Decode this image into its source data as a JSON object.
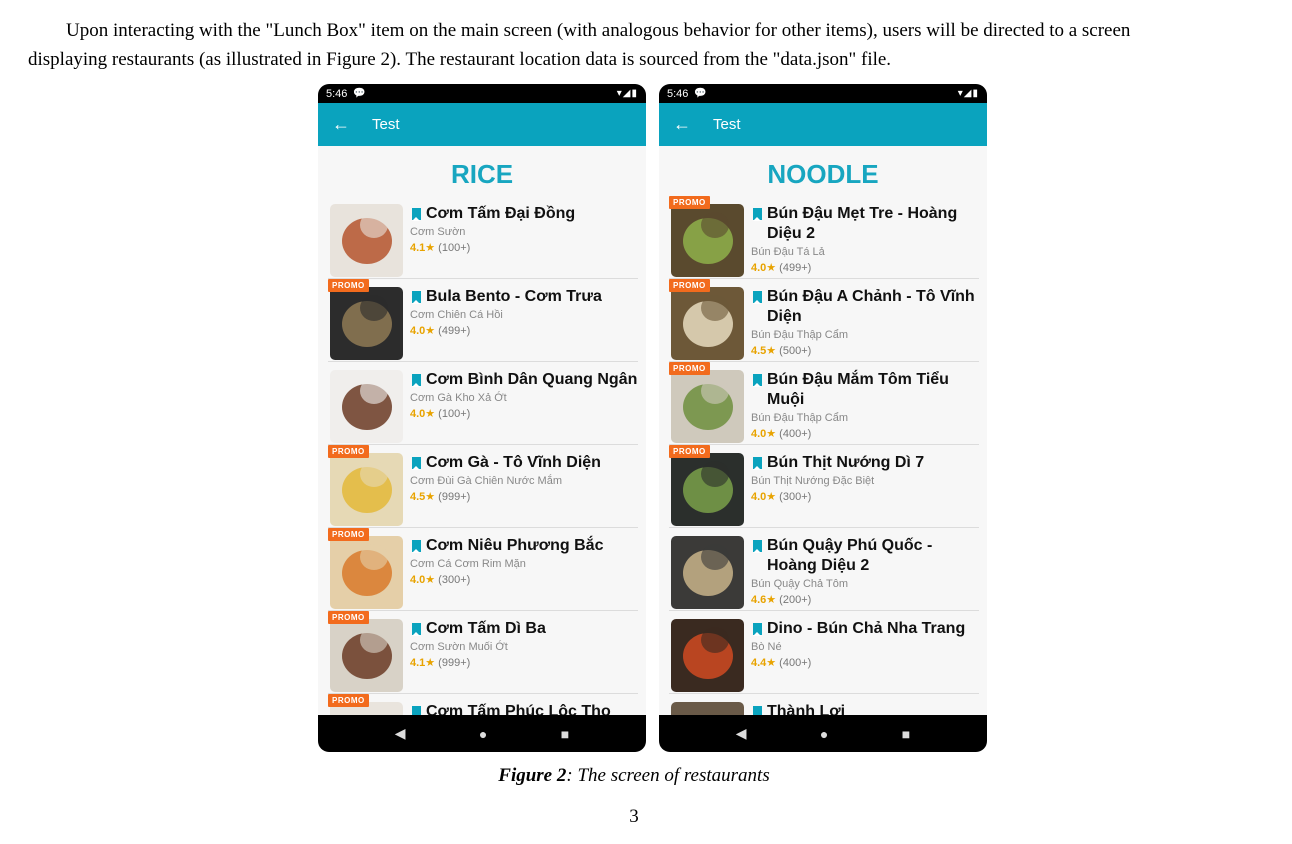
{
  "paragraph": {
    "line1": "Upon interacting with the \"Lunch Box\" item on the main screen (with analogous behavior for other items), users will be directed to a screen",
    "line2": "displaying restaurants (as illustrated in Figure 2). The restaurant location data is sourced from the \"data.json\" file."
  },
  "phones": [
    {
      "status": {
        "time": "5:46",
        "notif_icon": "chat-icon",
        "sys_icons": "wifi-signal-battery-icons"
      },
      "appbar": {
        "back_icon": "arrow-left-icon",
        "title": "Test"
      },
      "heading": "RICE",
      "items": [
        {
          "promo": false,
          "name": "Cơm Tấm Đại Đồng",
          "sub": "Cơm Sườn",
          "score": "4.1",
          "count": "(100+)",
          "colors": [
            "#e8e3dc",
            "#b5552e"
          ]
        },
        {
          "promo": true,
          "name": "Bula Bento - Cơm Trưa",
          "sub": "Cơm Chiên Cá Hồi",
          "score": "4.0",
          "count": "(499+)",
          "colors": [
            "#2c2c2c",
            "#8f7a55"
          ]
        },
        {
          "promo": false,
          "name": "Cơm Bình Dân Quang Ngân",
          "sub": "Cơm Gà Kho Xả Ớt",
          "score": "4.0",
          "count": "(100+)",
          "colors": [
            "#f0eeec",
            "#6b3a24"
          ]
        },
        {
          "promo": true,
          "name": "Cơm Gà - Tô Vĩnh Diện",
          "sub": "Cơm Đùi Gà Chiên Nước Mắm",
          "score": "4.5",
          "count": "(999+)",
          "colors": [
            "#e6d9b5",
            "#e3b83a"
          ]
        },
        {
          "promo": true,
          "name": "Cơm Niêu Phương Bắc",
          "sub": "Cơm Cá Cơm Rim Mặn",
          "score": "4.0",
          "count": "(300+)",
          "colors": [
            "#e5cfa8",
            "#d97a2b"
          ]
        },
        {
          "promo": true,
          "name": "Cơm Tấm Dì Ba",
          "sub": "Cơm Sườn Muối Ớt",
          "score": "4.1",
          "count": "(999+)",
          "colors": [
            "#d8d2c7",
            "#6b3b24"
          ]
        },
        {
          "promo": true,
          "name": "Cơm Tấm Phúc Lộc Thọ",
          "sub": "",
          "score": "",
          "count": "",
          "colors": [
            "#e9e4dd",
            "#c79a5a"
          ]
        }
      ],
      "nav": {
        "back": "◀",
        "home": "●",
        "recent": "■"
      }
    },
    {
      "status": {
        "time": "5:46",
        "notif_icon": "chat-icon",
        "sys_icons": "wifi-signal-battery-icons"
      },
      "appbar": {
        "back_icon": "arrow-left-icon",
        "title": "Test"
      },
      "heading": "NOODLE",
      "items": [
        {
          "promo": true,
          "name": "Bún Đậu Mẹt Tre - Hoàng Diệu 2",
          "sub": "Bún Đậu Tá Lả",
          "score": "4.0",
          "count": "(499+)",
          "colors": [
            "#5a4a2e",
            "#8fb04a"
          ]
        },
        {
          "promo": true,
          "name": "Bún Đậu A Chảnh - Tô Vĩnh Diện",
          "sub": "Bún Đậu Thập Cẩm",
          "score": "4.5",
          "count": "(500+)",
          "colors": [
            "#6d5838",
            "#e8dcc0"
          ]
        },
        {
          "promo": true,
          "name": "Bún Đậu Mắm Tôm Tiểu Muội",
          "sub": "Bún Đậu Thập Cẩm",
          "score": "4.0",
          "count": "(400+)",
          "colors": [
            "#cfc9bc",
            "#6f8f3e"
          ]
        },
        {
          "promo": true,
          "name": "Bún Thịt Nướng Dì 7",
          "sub": "Bún Thịt Nướng Đặc Biệt",
          "score": "4.0",
          "count": "(300+)",
          "colors": [
            "#2b2f2c",
            "#7aa04a"
          ]
        },
        {
          "promo": false,
          "name": "Bún Quậy Phú Quốc - Hoàng Diệu 2",
          "sub": "Bún Quậy Chả Tôm",
          "score": "4.6",
          "count": "(200+)",
          "colors": [
            "#3b3a38",
            "#c9b48a"
          ]
        },
        {
          "promo": false,
          "name": "Dino - Bún Chả Nha Trang",
          "sub": "Bò Né",
          "score": "4.4",
          "count": "(400+)",
          "colors": [
            "#3a2a20",
            "#d04a22"
          ]
        },
        {
          "promo": false,
          "name": "Thành Lợi",
          "sub": "",
          "score": "",
          "count": "",
          "colors": [
            "#6a5a48",
            "#bfa888"
          ]
        }
      ],
      "nav": {
        "back": "◀",
        "home": "●",
        "recent": "■"
      }
    }
  ],
  "promo_label": "PROMO",
  "star": "★",
  "caption": {
    "fig": "Figure 2",
    "text": ": The screen of restaurants"
  },
  "page_number": "3",
  "colors": {
    "primary": "#0aa3be",
    "heading": "#18a6c0",
    "promo": "#f26b1d",
    "rating": "#e8a300"
  }
}
